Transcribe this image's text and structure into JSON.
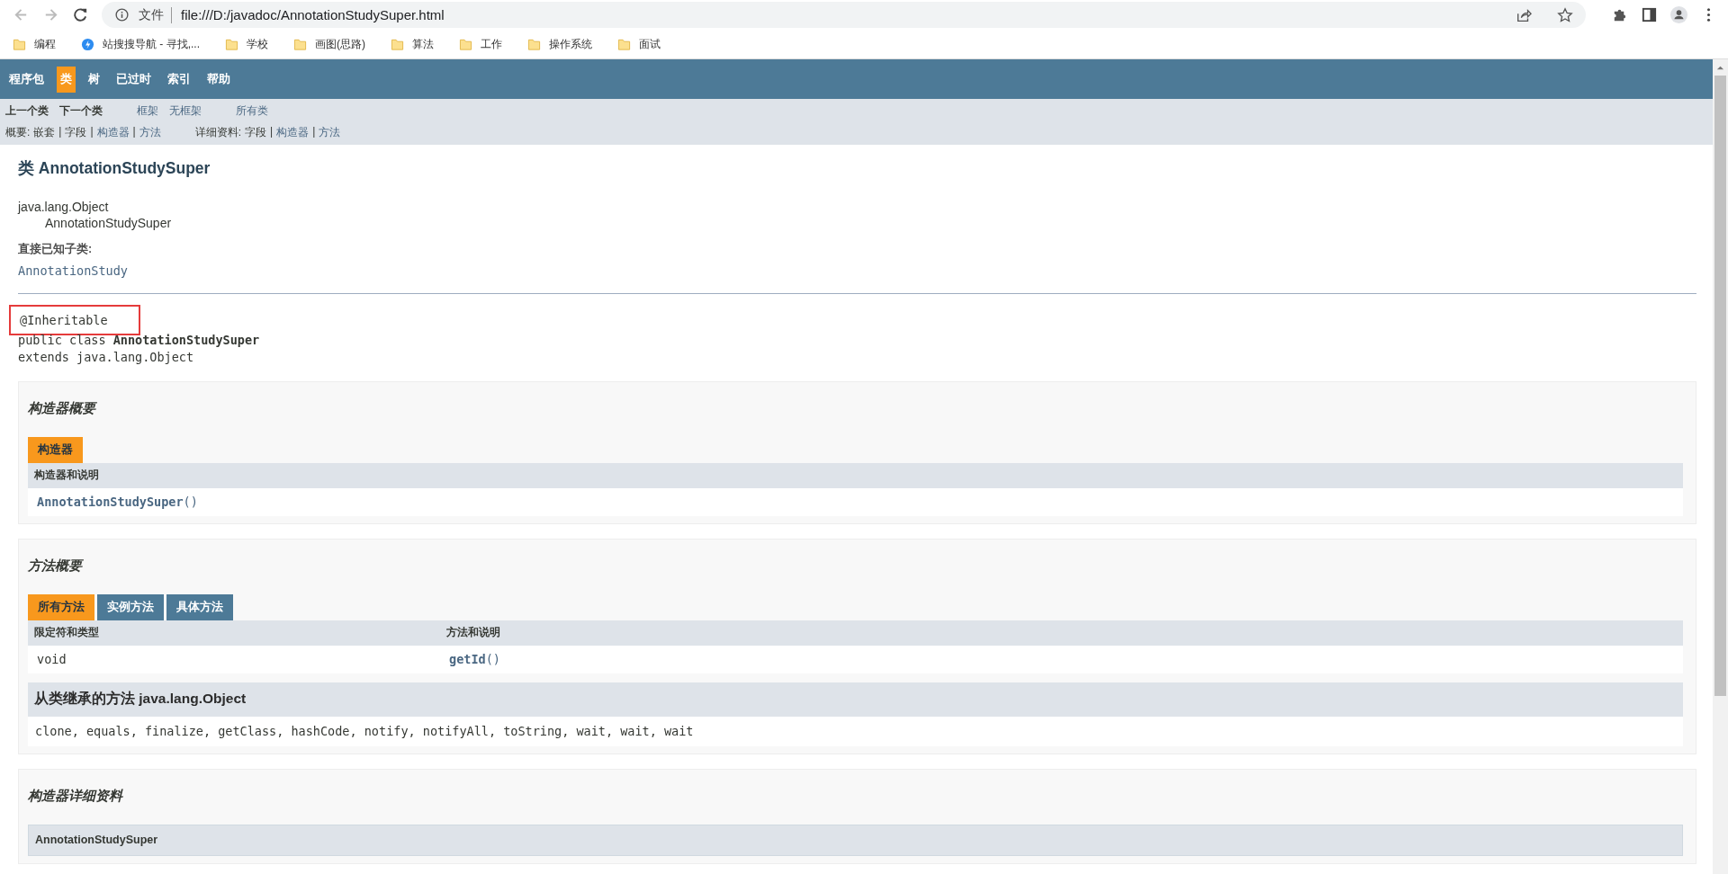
{
  "browser": {
    "back_disabled": true,
    "forward_disabled": true,
    "security_label": "文件",
    "url": "file:///D:/javadoc/AnnotationStudySuper.html",
    "bookmarks": [
      {
        "label": "编程",
        "kind": "folder"
      },
      {
        "label": "站搜搜导航 - 寻找,...",
        "kind": "site"
      },
      {
        "label": "学校",
        "kind": "folder"
      },
      {
        "label": "画图(思路)",
        "kind": "folder"
      },
      {
        "label": "算法",
        "kind": "folder"
      },
      {
        "label": "工作",
        "kind": "folder"
      },
      {
        "label": "操作系统",
        "kind": "folder"
      },
      {
        "label": "面试",
        "kind": "folder"
      }
    ]
  },
  "top_nav": [
    {
      "label": "程序包",
      "selected": false
    },
    {
      "label": "类",
      "selected": true
    },
    {
      "label": "树",
      "selected": false
    },
    {
      "label": "已过时",
      "selected": false
    },
    {
      "label": "索引",
      "selected": false
    },
    {
      "label": "帮助",
      "selected": false
    }
  ],
  "sub_nav": {
    "groups": [
      [
        {
          "label": "上一个类",
          "link": false
        },
        {
          "label": "下一个类",
          "link": false
        }
      ],
      [
        {
          "label": "框架",
          "link": true
        },
        {
          "label": "无框架",
          "link": true
        }
      ],
      [
        {
          "label": "所有类",
          "link": true
        }
      ]
    ],
    "separator": "|",
    "summary": {
      "label": "概要:",
      "items": [
        {
          "label": "嵌套",
          "link": false
        },
        {
          "label": "字段",
          "link": false
        },
        {
          "label": "构造器",
          "link": true
        },
        {
          "label": "方法",
          "link": true
        }
      ]
    },
    "detail": {
      "label": "详细资料:",
      "items": [
        {
          "label": "字段",
          "link": false
        },
        {
          "label": "构造器",
          "link": true
        },
        {
          "label": "方法",
          "link": true
        }
      ]
    }
  },
  "class_header": {
    "title": "类 AnnotationStudySuper",
    "inheritance": [
      "java.lang.Object",
      "AnnotationStudySuper"
    ],
    "subclasses_label": "直接已知子类:",
    "subclasses": [
      "AnnotationStudy"
    ]
  },
  "signature": {
    "annotation": "@Inheritable",
    "annotation_highlighted": true,
    "declaration": "public class **AnnotationStudySuper**",
    "extends": "extends java.lang.Object"
  },
  "constructor_summary": {
    "heading": "构造器概要",
    "tabs": [
      {
        "label": "构造器",
        "selected": true
      }
    ],
    "columns": [
      "构造器和说明"
    ],
    "rows": [
      {
        "name": "AnnotationStudySuper",
        "params": "()"
      }
    ]
  },
  "method_summary": {
    "heading": "方法概要",
    "tabs": [
      {
        "label": "所有方法",
        "selected": true
      },
      {
        "label": "实例方法",
        "selected": false
      },
      {
        "label": "具体方法",
        "selected": false
      }
    ],
    "columns": [
      "限定符和类型",
      "方法和说明"
    ],
    "rows": [
      {
        "modifier": "void",
        "name": "getId",
        "params": "()"
      }
    ],
    "inherited": {
      "heading": "从类继承的方法 java.lang.Object",
      "methods": "clone, equals, finalize, getClass, hashCode, notify, notifyAll, toString, wait, wait, wait"
    }
  },
  "constructor_detail": {
    "heading": "构造器详细资料",
    "members": [
      "AnnotationStudySuper"
    ]
  }
}
